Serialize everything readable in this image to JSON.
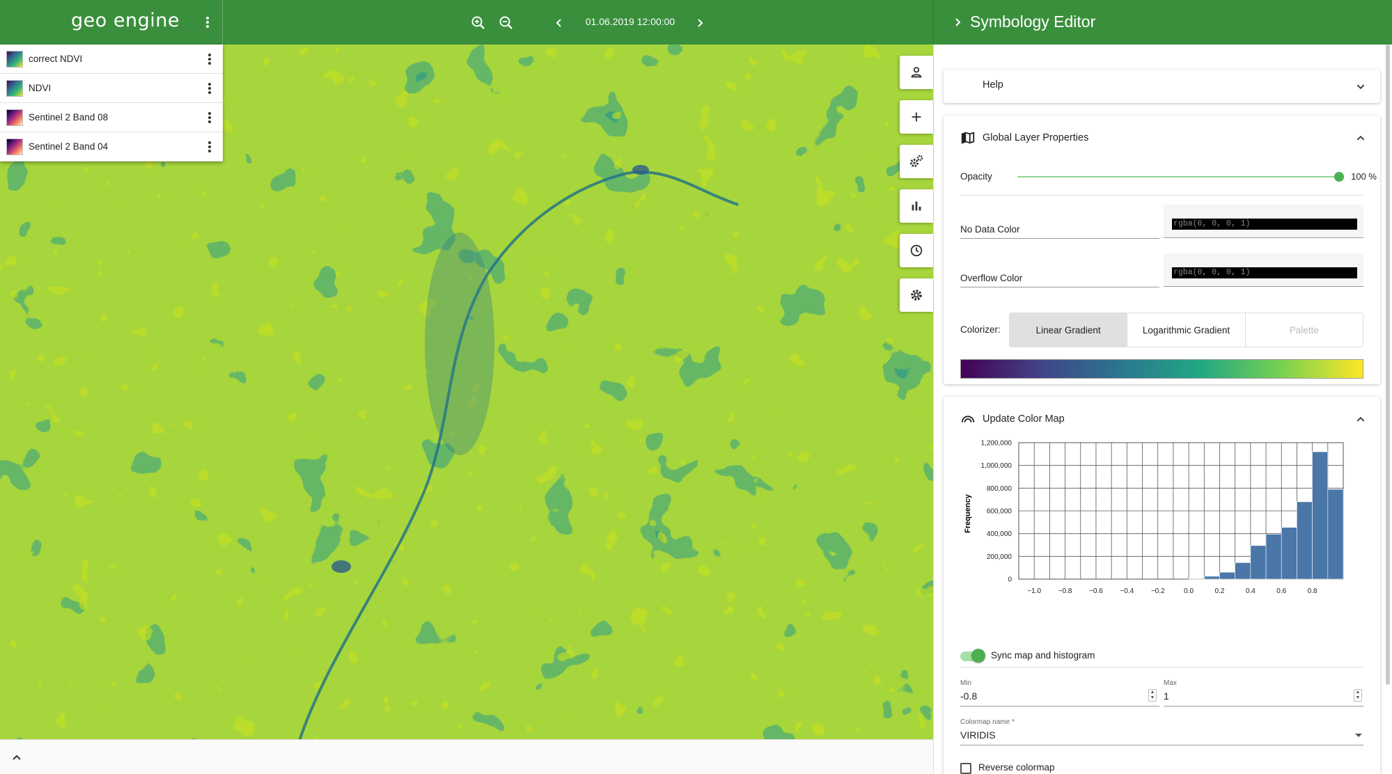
{
  "app": {
    "logo": "geo engine"
  },
  "toolbar": {
    "time": "01.06.2019 12:00:00"
  },
  "layers": [
    {
      "name": "correct NDVI",
      "thumb": "viridis"
    },
    {
      "name": "NDVI",
      "thumb": "viridis"
    },
    {
      "name": "Sentinel 2 Band 08",
      "thumb": "magma"
    },
    {
      "name": "Sentinel 2 Band 04",
      "thumb": "magma"
    }
  ],
  "tools": [
    "account-icon",
    "add-data-icon",
    "operators-icon",
    "plot-icon",
    "time-icon",
    "settings-icon"
  ],
  "panel": {
    "title": "Symbology Editor",
    "help": {
      "title": "Help"
    },
    "global": {
      "title": "Global Layer Properties",
      "opacity_label": "Opacity",
      "opacity": 100,
      "opacity_value": "100 %",
      "no_data_label": "No Data Color",
      "no_data_value": "rgba(0, 0, 0, 1)",
      "overflow_label": "Overflow Color",
      "overflow_value": "rgba(0, 0, 0, 1)",
      "colorizer_label": "Colorizer:",
      "colorizer_options": [
        "Linear Gradient",
        "Logarithmic Gradient",
        "Palette"
      ],
      "colorizer_selected": "Linear Gradient"
    },
    "colormap": {
      "title": "Update Color Map",
      "sync_label": "Sync map and histogram",
      "sync_on": true,
      "min_caption": "Min",
      "min_value": "-0.8",
      "max_caption": "Max",
      "max_value": "1",
      "name_caption": "Colormap name *",
      "name_value": "VIRIDIS",
      "reverse_label": "Reverse colormap"
    }
  },
  "colors": {
    "primary": "#3a8f3d",
    "accent": "#4caf50",
    "bar": "#4a76a8"
  },
  "chart_data": {
    "type": "bar",
    "xlabel": "",
    "ylabel": "Frequency",
    "x_ticks": [
      "−1.0",
      "−0.8",
      "−0.6",
      "−0.4",
      "−0.2",
      "0.0",
      "0.2",
      "0.4",
      "0.6",
      "0.8"
    ],
    "y_ticks": [
      "0",
      "200,000",
      "400,000",
      "600,000",
      "800,000",
      "1,000,000",
      "1,200,000"
    ],
    "ylim": [
      0,
      1200000
    ],
    "xlim": [
      -1.1,
      1.0
    ],
    "bin_edges": [
      -1.1,
      -1.0,
      -0.9,
      -0.8,
      -0.7,
      -0.6,
      -0.5,
      -0.4,
      -0.3,
      -0.2,
      -0.1,
      0.0,
      0.1,
      0.2,
      0.3,
      0.4,
      0.5,
      0.6,
      0.7,
      0.8,
      0.9,
      1.0
    ],
    "values": [
      0,
      0,
      0,
      0,
      0,
      0,
      0,
      0,
      0,
      0,
      0,
      5000,
      25000,
      60000,
      145000,
      295000,
      395000,
      455000,
      680000,
      1120000,
      790000
    ],
    "grid": true
  }
}
